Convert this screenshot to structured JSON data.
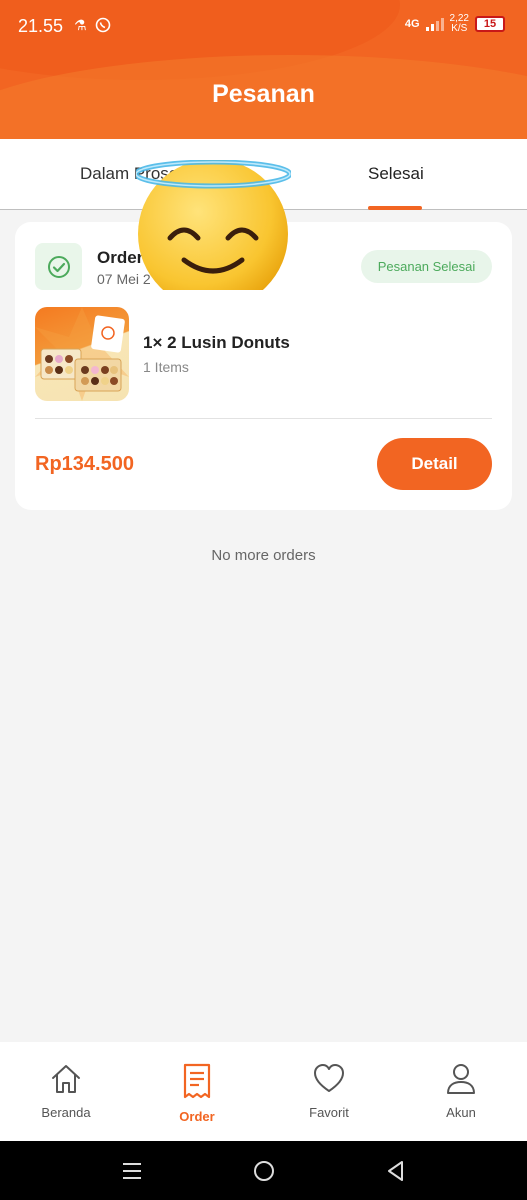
{
  "status_bar": {
    "time": "21.55",
    "network": "4G",
    "speed_value": "2,22",
    "speed_unit": "K/S",
    "battery": "15"
  },
  "header": {
    "title": "Pesanan"
  },
  "tabs": [
    {
      "label": "Dalam Proses"
    },
    {
      "label": "Selesai",
      "active": true
    }
  ],
  "order": {
    "title": "Order",
    "date": "07 Mei 2",
    "status": "Pesanan Selesai",
    "item_name": "1× 2 Lusin Donuts",
    "item_count": "1 Items",
    "price": "Rp134.500",
    "detail_label": "Detail"
  },
  "empty_note": "No more orders",
  "bottom_nav": [
    {
      "label": "Beranda",
      "icon": "home-icon"
    },
    {
      "label": "Order",
      "icon": "receipt-icon",
      "active": true
    },
    {
      "label": "Favorit",
      "icon": "heart-icon"
    },
    {
      "label": "Akun",
      "icon": "user-icon"
    }
  ],
  "colors": {
    "accent": "#f26522",
    "success": "#4caa5c",
    "success_bg": "#e8f5ea"
  }
}
